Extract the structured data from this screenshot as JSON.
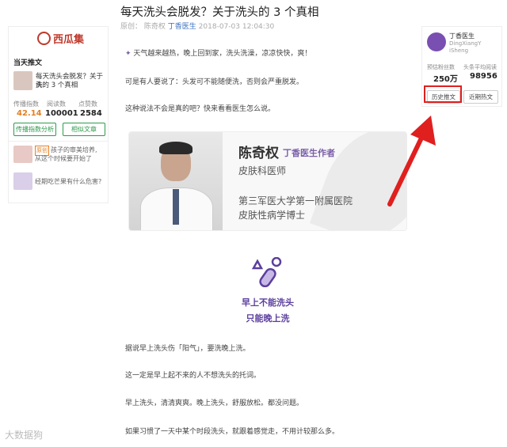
{
  "left_panel": {
    "logo": "西瓜集",
    "section_title": "当天推文",
    "article_title_line1": "每天洗头会脱发？关于洗",
    "article_title_line2": "头的 3 个真相",
    "stats": [
      {
        "label": "传播指数",
        "value": "42.14",
        "color": "#e67e22"
      },
      {
        "label": "阅读数",
        "value": "100001",
        "color": "#222222"
      },
      {
        "label": "点赞数",
        "value": "2584",
        "color": "#222222"
      }
    ],
    "btn_analysis": "传播指数分析",
    "btn_similar": "相似文章",
    "related": [
      {
        "tag": "原创",
        "line1": "孩子的审美培养,",
        "line2": "从这个时候要开始了"
      },
      {
        "tag": "",
        "line1": "经期吃芒果有什么危害?",
        "line2": ""
      }
    ]
  },
  "article": {
    "title": "每天洗头会脱发？关于洗头的 3 个真相",
    "meta_source": "原创：",
    "meta_author": "陈奇权",
    "meta_account": "丁香医生",
    "meta_date": "2018-07-03 12:04:30",
    "p1": "天气越来越热，晚上回到家，洗头洗澡，凉凉快快，爽！",
    "p2": "可是有人要说了：头发可不能随便洗，否则会严重脱发。",
    "p3": "这种说法不会是真的吧？快来看看医生怎么说。",
    "card_name": "陈奇权",
    "card_role": "丁香医生作者",
    "card_job": "皮肤科医师",
    "card_hospital": "第三军医大学第一附属医院",
    "card_degree": "皮肤性病学博士",
    "heading1": "早上不能洗头",
    "heading2": "只能晚上洗",
    "p4": "据说早上洗头伤「阳气」，要洗晚上洗。",
    "p5": "这一定是早上起不来的人不想洗头的托词。",
    "p6": "早上洗头，清清爽爽。晚上洗头，舒服放松。都没问题。",
    "p7": "如果习惯了一天中某个时段洗头，就跟着感觉走，不用计较那么多。"
  },
  "right_panel": {
    "account_name": "丁香医生",
    "account_id1": "DingXiangY",
    "account_id2": "iSheng",
    "fans_label": "预估粉丝数",
    "fans_value": "250万",
    "avg_label": "头条平均阅读",
    "avg_value": "98956",
    "btn_history": "历史推文",
    "btn_recent": "近期热文",
    "highlight_color": "#e01f1f"
  },
  "watermark": "大数据狗"
}
